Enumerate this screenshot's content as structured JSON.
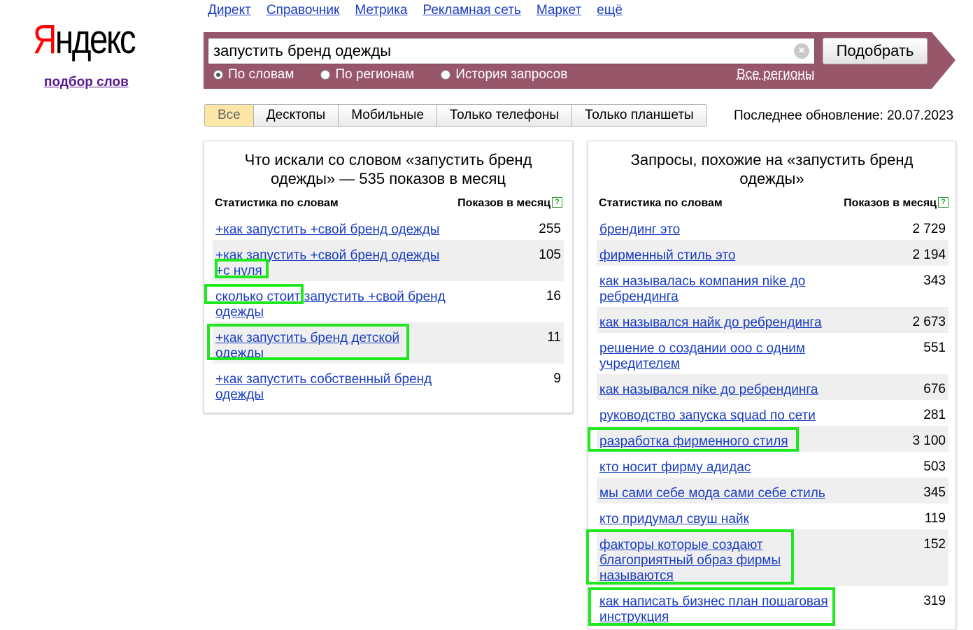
{
  "logo": {
    "first": "Я",
    "rest": "ндекс",
    "subtitle": "подбор слов"
  },
  "topnav": [
    "Директ",
    "Справочник",
    "Метрика",
    "Рекламная сеть",
    "Маркет",
    "ещё"
  ],
  "search": {
    "query": "запустить бренд одежды",
    "button": "Подобрать",
    "radios": [
      "По словам",
      "По регионам",
      "История запросов"
    ],
    "selected_radio": "По словам",
    "regions_link": "Все регионы"
  },
  "tabs": [
    "Все",
    "Десктопы",
    "Мобильные",
    "Только телефоны",
    "Только планшеты"
  ],
  "active_tab": "Все",
  "last_update": "Последнее обновление: 20.07.2023",
  "left_panel": {
    "title": "Что искали со словом «запустить бренд одежды» — 535 показов в месяц",
    "col_keyword": "Статистика по словам",
    "col_count": "Показов в месяц",
    "rows": [
      {
        "keyword": "+как запустить +свой бренд одежды",
        "count": "255"
      },
      {
        "keyword": "+как запустить +свой бренд одежды +с нуля",
        "count": "105"
      },
      {
        "keyword": "сколько стоит запустить +свой бренд одежды",
        "count": "16"
      },
      {
        "keyword": "+как запустить бренд детской одежды",
        "count": "11"
      },
      {
        "keyword": "+как запустить собственный бренд одежды",
        "count": "9"
      }
    ]
  },
  "right_panel": {
    "title": "Запросы, похожие на «запустить бренд одежды»",
    "col_keyword": "Статистика по словам",
    "col_count": "Показов в месяц",
    "rows": [
      {
        "keyword": "брендинг это",
        "count": "2 729"
      },
      {
        "keyword": "фирменный стиль это",
        "count": "2 194"
      },
      {
        "keyword": "как называлась компания nike до ребрендинга",
        "count": "343"
      },
      {
        "keyword": "как назывался найк до ребрендинга",
        "count": "2 673"
      },
      {
        "keyword": "решение о создании ооо с одним учредителем",
        "count": "551"
      },
      {
        "keyword": "как назывался nike до ребрендинга",
        "count": "676"
      },
      {
        "keyword": "руководство запуска squad по сети",
        "count": "281"
      },
      {
        "keyword": "разработка фирменного стиля",
        "count": "3 100"
      },
      {
        "keyword": "кто носит фирму адидас",
        "count": "503"
      },
      {
        "keyword": "мы сами себе мода сами себе стиль",
        "count": "345"
      },
      {
        "keyword": "кто придумал свуш найк",
        "count": "119"
      },
      {
        "keyword": "факторы которые создают благоприятный образ фирмы называются",
        "count": "152"
      },
      {
        "keyword": "как написать бизнес план пошаговая инструкция",
        "count": "319"
      }
    ]
  },
  "colors": {
    "band": "#98566a",
    "link": "#1a3dc1",
    "highlight": "#1ee81e",
    "active_tab": "#fce7a6"
  }
}
